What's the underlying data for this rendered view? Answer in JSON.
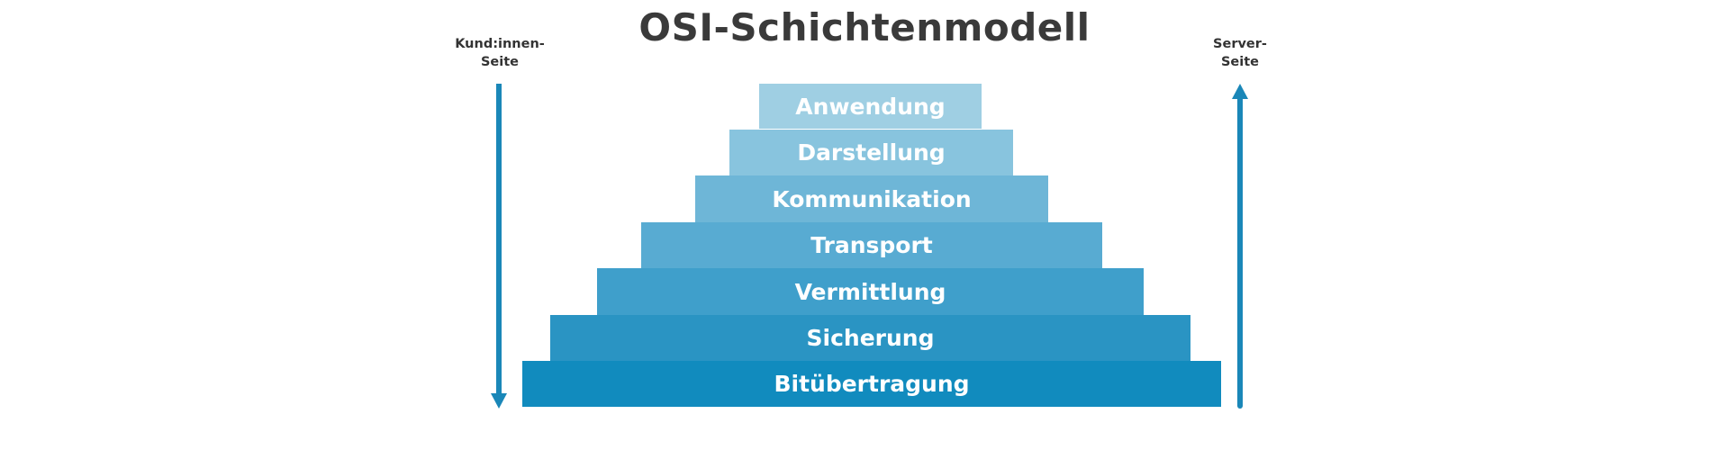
{
  "title": "OSI-Schichtenmodell",
  "left_side": {
    "line1": "Kund:innen-",
    "line2": "Seite",
    "arrow_direction": "down"
  },
  "right_side": {
    "line1": "Server-",
    "line2": "Seite",
    "arrow_direction": "up"
  },
  "layers": [
    {
      "label": "Anwendung",
      "color": "#9fcfe3"
    },
    {
      "label": "Darstellung",
      "color": "#88c4de"
    },
    {
      "label": "Kommunikation",
      "color": "#6eb6d7"
    },
    {
      "label": "Transport",
      "color": "#58abd2"
    },
    {
      "label": "Vermittlung",
      "color": "#3f9fcb"
    },
    {
      "label": "Sicherung",
      "color": "#2a94c3"
    },
    {
      "label": "Bitübertragung",
      "color": "#118bbe"
    }
  ],
  "colors": {
    "arrow": "#1a87b8",
    "title": "#3a3a3a",
    "side_text": "#333333"
  }
}
